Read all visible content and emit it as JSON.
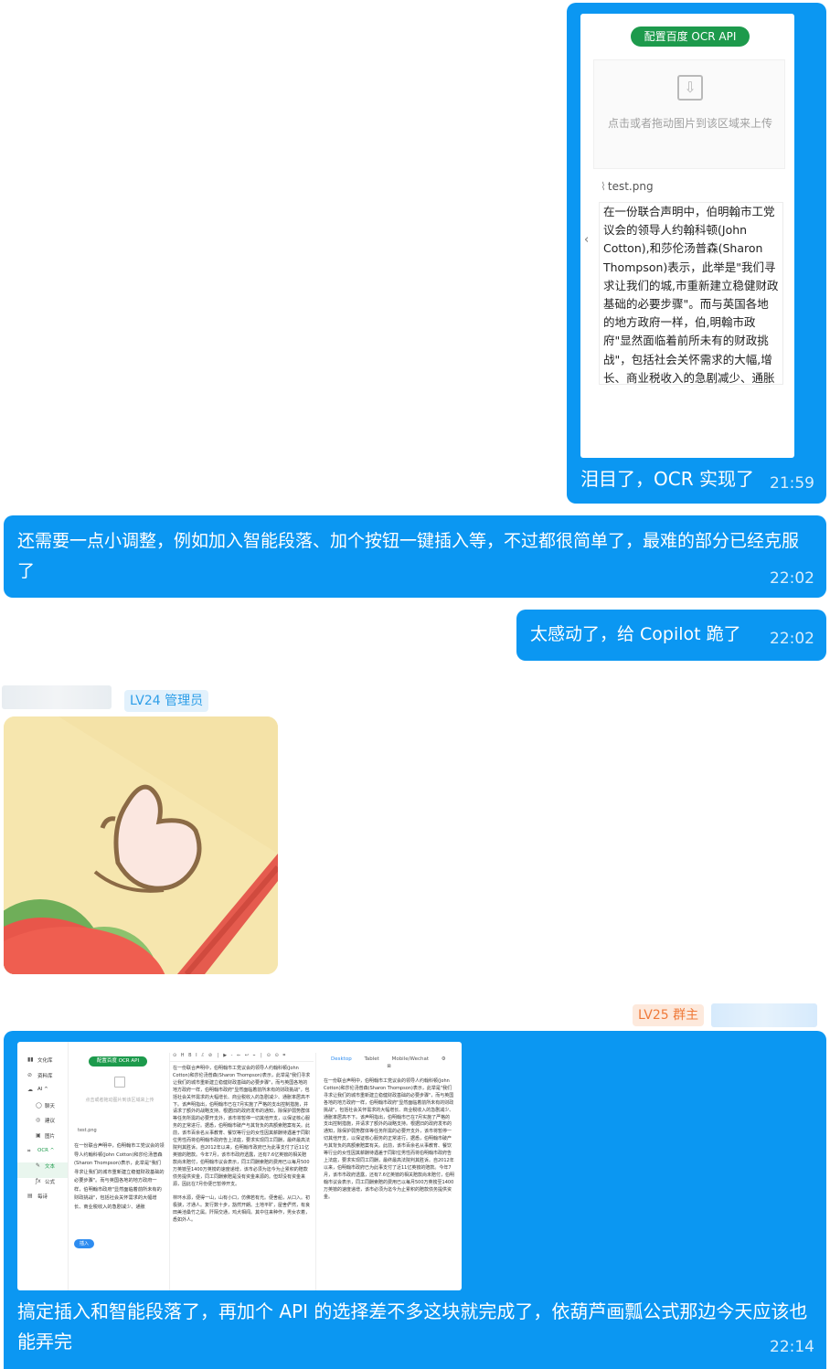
{
  "message1": {
    "ocr_button": "配置百度 OCR API",
    "upload_hint": "点击或者拖动图片到该区域来上传",
    "file_name": "test.png",
    "ocr_result": "在一份联合声明中，伯明翰市工党议会的领导人约翰科顿(John Cotton),和莎伦汤普森(Sharon Thompson)表示，此举是\"我们寻求让我们的城,市重新建立稳健财政基础的必要步骤\"。而与英国各地的地方政府一样，伯,明翰市政府\"显然面临着前所未有的财政挑战\"，包括社会关怀需求的大幅,增长、商业税收入的急剧减少、通胀",
    "text": "泪目了，OCR 实现了",
    "time": "21:59"
  },
  "message2": {
    "text": "还需要一点小调整，例如加入智能段落、加个按钮一键插入等，不过都很简单了，最难的部分已经克服了",
    "time": "22:02"
  },
  "message3": {
    "text": "太感动了，给 Copilot 跪了",
    "time": "22:02"
  },
  "user1": {
    "badge": "LV24 管理员"
  },
  "user2": {
    "badge": "LV25 群主"
  },
  "message4": {
    "text": "搞定插入和智能段落了，再加个 API 的选择差不多这块就完成了，依葫芦画瓢公式那边今天应该也能弄完",
    "time": "22:14",
    "app": {
      "sidebar": [
        {
          "icon": "▮▮",
          "label": "文化库"
        },
        {
          "icon": "⊘",
          "label": "资料库"
        },
        {
          "icon": "☁",
          "label": "AI  ^"
        },
        {
          "icon": "◯",
          "label": "聊天"
        },
        {
          "icon": "◎",
          "label": "建议"
        },
        {
          "icon": "▣",
          "label": "图片"
        },
        {
          "icon": "⌗",
          "label": "OCR  ^"
        },
        {
          "icon": "",
          "label": "文本"
        },
        {
          "icon": "ƒx",
          "label": "公式"
        },
        {
          "icon": "▤",
          "label": "每诗"
        }
      ],
      "ocr_button": "配置百度 OCR API",
      "upload_hint": "点击或者拖动图片到该区域来上传",
      "file_name": "test.png",
      "ocr_result": "在一份联合声明中，伯明翰市工党议会的领导人约翰科顿(John Cotton)和莎伦汤普森(Sharon Thompson)表示，此举是\"我们寻求让我们的城市重新建立稳健财政基础的必要步骤\"。而与英国各地的地方政府一样，伯明翰市政府\"显然面临着前所未有的财政挑战\"，包括社会关怀需求的大幅增长、商业税收入的急剧减少、通胀",
      "insert_button": "插入",
      "toolbar": "⊙ H B I ℰ ⊘ │ ▶ - ⇐ ↩ ⌁ │ ⊙ ⊙ ⌗",
      "editor_text": "在一份联合声明中，伯明翰市工党议会的领导人约翰科顿(John Cotton)和莎伦汤普森(Sharon Thompson)表示，此举是\"我们寻求让我们的城市重新建立稳健财政基础的必要步骤\"，而与英国各地的地方政府一样，伯明翰市政府\"显然面临着前所未有的财政挑战\"，包括社会关怀需求的大幅增长、商业税收入的急剧减少、通胀率居高不下。该声明指出，伯明翰市已在7月实施了严格的支出控制措施，并请求了额外的战略支持。根据旧的政府发布的通知，除保护弱势群体等任务所需的必要开支外，该市将暂停一切其他开支，以保证核心服务的正常进行。据悉，伯明翰市破产与其背负的高额索赔案有关。此前，该市百余名从事教育、餐饮等行业的女性因其薪酬待遇差于同职位男性而将伯明翰市政府告上法庭，要求实现同工同酬，最终最高法院判其胜诉。自2012年以来，伯明翰市政府已为此事支付了近11亿英镑的赔款。今年7月，该市市政府透露，还有7.6亿英镑的相关赔款尚未赔付，伯明翰市议会表示，同工同酬索赔的费用已以每月500万英镑至1400万英镑的速度递增，该市必须为迄今为止累积的赔款债务提供资金，同工同酬索赔是没有资金来源的。但却没有资金来源，因此在7月份便已暂停开支。",
      "editor_text2": "林环水源，便得一山，山有小口，仿佛若有光。便舍船，从口入。初极狭，才通人。复行数十步，豁然开朗。土地平旷，屋舍俨然，有良田美池桑竹之属。阡陌交通，鸡犬相闻。其中往来种作，男女衣着，悉如外人。",
      "preview_tabs": [
        "Desktop",
        "Tablet",
        "Mobile/Wechat"
      ],
      "preview_subtab": "⊠",
      "preview_text": "在一份联合声明中，伯明翰市工党议会的领导人约翰科顿(John Cotton)和莎伦汤普森(Sharon Thompson)表示，此举是\"我们寻求让我们的城市重新建立稳健财政基础的必要步骤\"，而与英国各地的地方政府一样，伯明翰市政府\"显然面临着前所未有的财政挑战\"，包括社会关怀需求的大幅增长、商业税收入的急剧减少、通胀率居高不下。该声明指出，伯明翰市已在7月实施了严格的支出控制措施，并请求了额外的战略支持。根据旧的政府发布的通知，除保护弱势群体等任务所需的必要开支外，该市将暂停一切其他开支，以保证核心服务的正常进行。据悉，伯明翰市破产与其背负的高额索赔案有关。此前，该市百余名从事教育、餐饮等行业的女性因其薪酬待遇差于同职位男性而将伯明翰市政府告上法庭，要求实现同工同酬，最终最高法院判其胜诉。自2012年以来，伯明翰市政府已为此事支付了近11亿英镑的赔款。今年7月，该市市政府透露，还有7.6亿英镑的相关赔款尚未赔付，伯明翰市议会表示，同工同酬索赔的费用已以每月500万英镑至1400万英镑的速度递增，该市必须为迄今为止累积的赔款债务提供资金。"
    }
  },
  "colors": {
    "bubble": "#0b97f2",
    "ocr_green": "#1d9a4c",
    "admin_badge": "#2d9ee8",
    "owner_badge": "#ef7a3a"
  }
}
